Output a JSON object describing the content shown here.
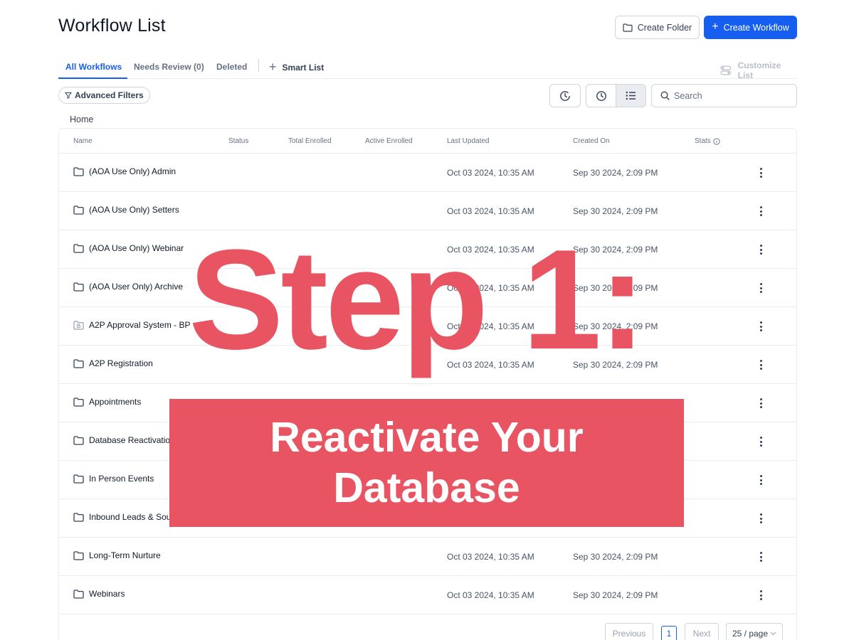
{
  "header": {
    "title": "Workflow List",
    "create_folder_label": "Create Folder",
    "create_workflow_label": "Create Workflow"
  },
  "tabs": {
    "all": "All Workflows",
    "review": "Needs Review (0)",
    "deleted": "Deleted",
    "smart_list": "Smart List",
    "customize": "Customize List"
  },
  "toolbar": {
    "advanced_filters": "Advanced Filters",
    "search_placeholder": "Search"
  },
  "breadcrumb": "Home",
  "table": {
    "columns": [
      "Name",
      "Status",
      "Total Enrolled",
      "Active Enrolled",
      "Last Updated",
      "Created On",
      "Stats"
    ],
    "rows": [
      {
        "name": "(AOA Use Only) Admin",
        "updated": "Oct 03 2024, 10:35 AM",
        "created": "Sep 30 2024, 2:09 PM",
        "icon": "folder-icon"
      },
      {
        "name": "(AOA Use Only) Setters",
        "updated": "Oct 03 2024, 10:35 AM",
        "created": "Sep 30 2024, 2:09 PM",
        "icon": "folder-icon"
      },
      {
        "name": "(AOA Use Only) Webinar",
        "updated": "Oct 03 2024, 10:35 AM",
        "created": "Sep 30 2024, 2:09 PM",
        "icon": "folder-icon"
      },
      {
        "name": "(AOA User Only) Archive",
        "updated": "Oct 03 2024, 10:35 AM",
        "created": "Sep 30 2024, 2:09 PM",
        "icon": "folder-icon"
      },
      {
        "name": "A2P Approval System - BP",
        "updated": "Oct 03 2024, 10:35 AM",
        "created": "Sep 30 2024, 2:09 PM",
        "icon": "locked-folder-icon"
      },
      {
        "name": "A2P Registration",
        "updated": "Oct 03 2024, 10:35 AM",
        "created": "Sep 30 2024, 2:09 PM",
        "icon": "folder-icon"
      },
      {
        "name": "Appointments",
        "updated": "",
        "created": "",
        "icon": "folder-icon"
      },
      {
        "name": "Database Reactivation",
        "updated": "",
        "created": "",
        "icon": "folder-icon"
      },
      {
        "name": "In Person Events",
        "updated": "",
        "created": "",
        "icon": "folder-icon"
      },
      {
        "name": "Inbound Leads & Sou",
        "updated": "",
        "created": "",
        "icon": "folder-icon"
      },
      {
        "name": "Long-Term Nurture",
        "updated": "Oct 03 2024, 10:35 AM",
        "created": "Sep 30 2024, 2:09 PM",
        "icon": "folder-icon"
      },
      {
        "name": "Webinars",
        "updated": "Oct 03 2024, 10:35 AM",
        "created": "Sep 30 2024, 2:09 PM",
        "icon": "folder-icon"
      }
    ]
  },
  "pagination": {
    "previous": "Previous",
    "current": "1",
    "next": "Next",
    "page_size": "25 / page"
  },
  "overlay": {
    "title": "Step 1:",
    "subtitle": "Reactivate Your Database"
  },
  "colors": {
    "accent": "#155eef",
    "overlay": "#e85461"
  }
}
